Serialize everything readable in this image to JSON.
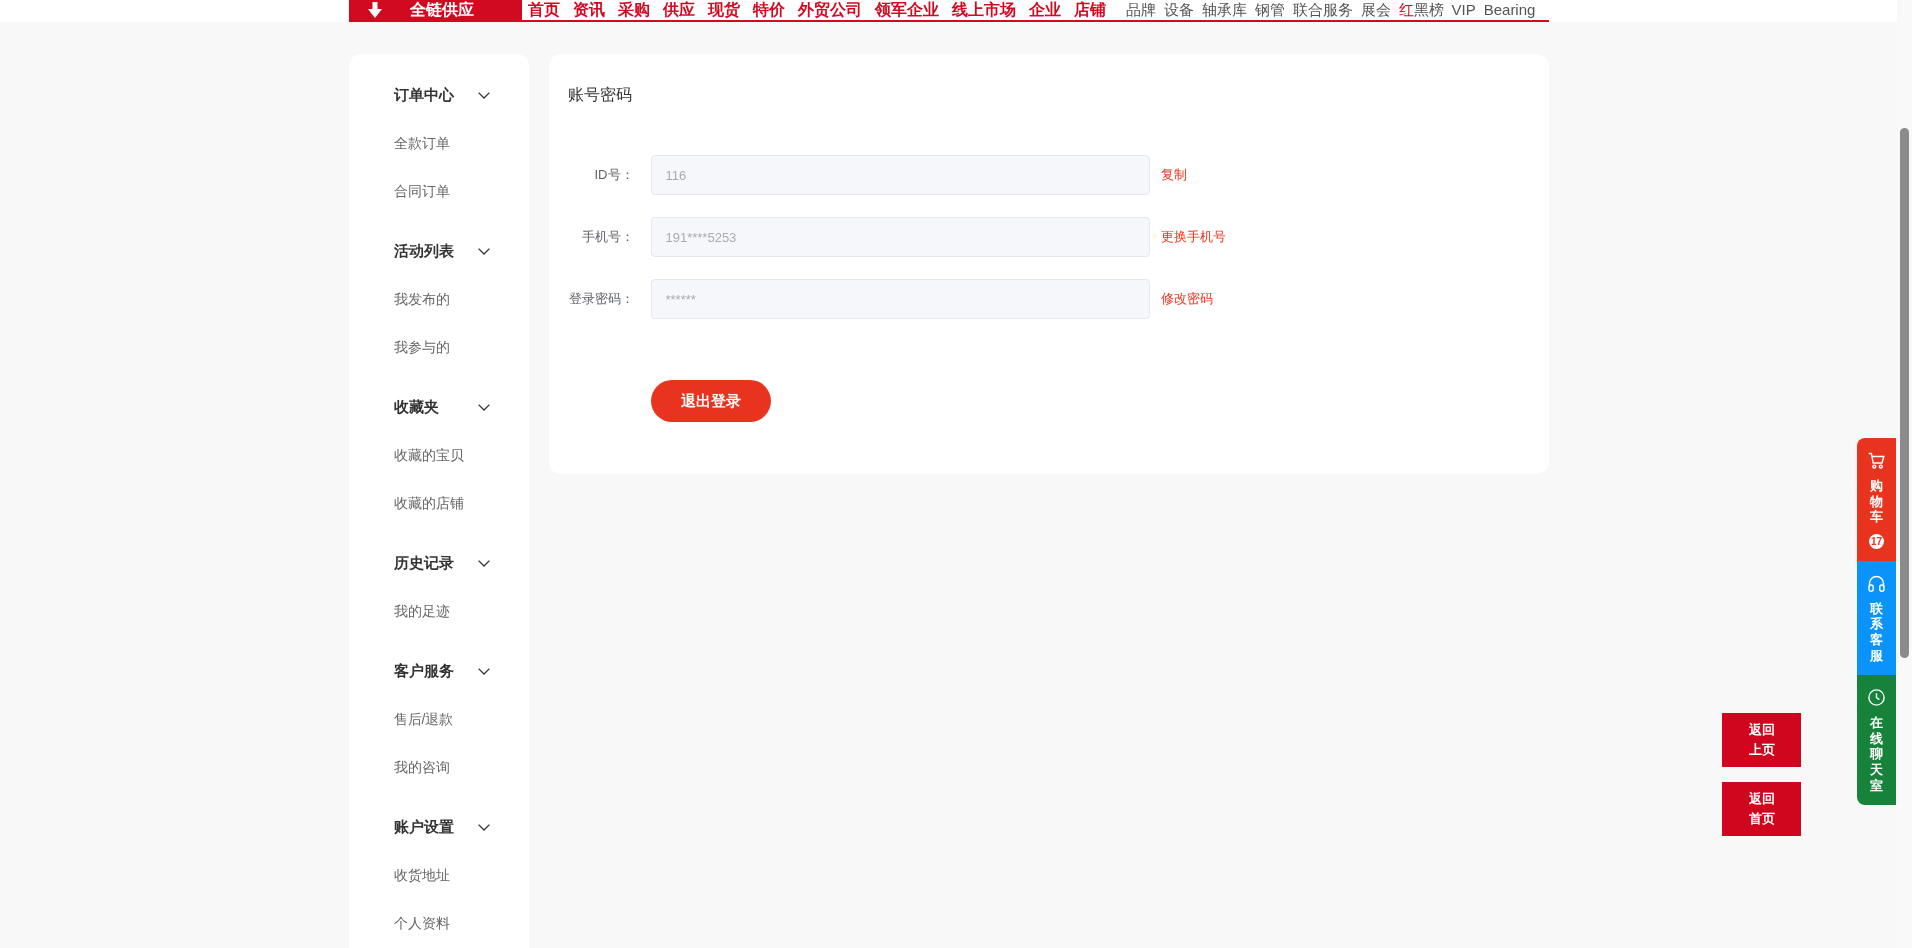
{
  "header": {
    "category_button": {
      "label": "全链供应"
    },
    "main_links": [
      "首页",
      "资讯",
      "采购",
      "供应",
      "现货",
      "特价",
      "外贸公司",
      "领军企业",
      "线上市场",
      "企业",
      "店铺"
    ],
    "more_links": [
      {
        "parts": [
          {
            "text": "品牌",
            "accent": false
          }
        ]
      },
      {
        "parts": [
          {
            "text": "设备",
            "accent": false
          }
        ]
      },
      {
        "parts": [
          {
            "text": "轴承库",
            "accent": false
          }
        ]
      },
      {
        "parts": [
          {
            "text": "钢管",
            "accent": false
          }
        ]
      },
      {
        "parts": [
          {
            "text": "联合服务",
            "accent": false
          }
        ]
      },
      {
        "parts": [
          {
            "text": "展会",
            "accent": false
          }
        ]
      },
      {
        "parts": [
          {
            "text": "红",
            "accent": true
          },
          {
            "text": "黑榜",
            "accent": false
          }
        ]
      },
      {
        "parts": [
          {
            "text": "VIP",
            "accent": false
          }
        ]
      },
      {
        "parts": [
          {
            "text": "Bearing",
            "accent": false
          }
        ]
      }
    ]
  },
  "sidebar": {
    "groups": [
      {
        "title": "订单中心",
        "expanded": true,
        "items": [
          "全款订单",
          "合同订单"
        ]
      },
      {
        "title": "活动列表",
        "expanded": true,
        "items": [
          "我发布的",
          "我参与的"
        ]
      },
      {
        "title": "收藏夹",
        "expanded": true,
        "items": [
          "收藏的宝贝",
          "收藏的店铺"
        ]
      },
      {
        "title": "历史记录",
        "expanded": true,
        "items": [
          "我的足迹"
        ]
      },
      {
        "title": "客户服务",
        "expanded": true,
        "items": [
          "售后/退款",
          "我的咨询"
        ]
      },
      {
        "title": "账户设置",
        "expanded": true,
        "items": [
          "收货地址",
          "个人资料"
        ]
      }
    ]
  },
  "account": {
    "title": "账号密码",
    "fields": [
      {
        "label": "ID号：",
        "value": "116",
        "disabled": true,
        "action": "复制"
      },
      {
        "label": "手机号：",
        "value": "191****5253",
        "disabled": true,
        "action": "更换手机号"
      },
      {
        "label": "登录密码：",
        "value": "******",
        "disabled": true,
        "action": "修改密码"
      }
    ],
    "logout_button": "退出登录"
  },
  "side_tabs": [
    {
      "kind": "cart",
      "label": "购物车",
      "color": "#e8341f",
      "badge": "17"
    },
    {
      "kind": "service",
      "label": "联系客服",
      "color": "#0a94fb"
    },
    {
      "kind": "chat",
      "label": "在线聊天室",
      "color": "#17833a"
    }
  ],
  "back_buttons": [
    "返回上页",
    "返回首页"
  ]
}
